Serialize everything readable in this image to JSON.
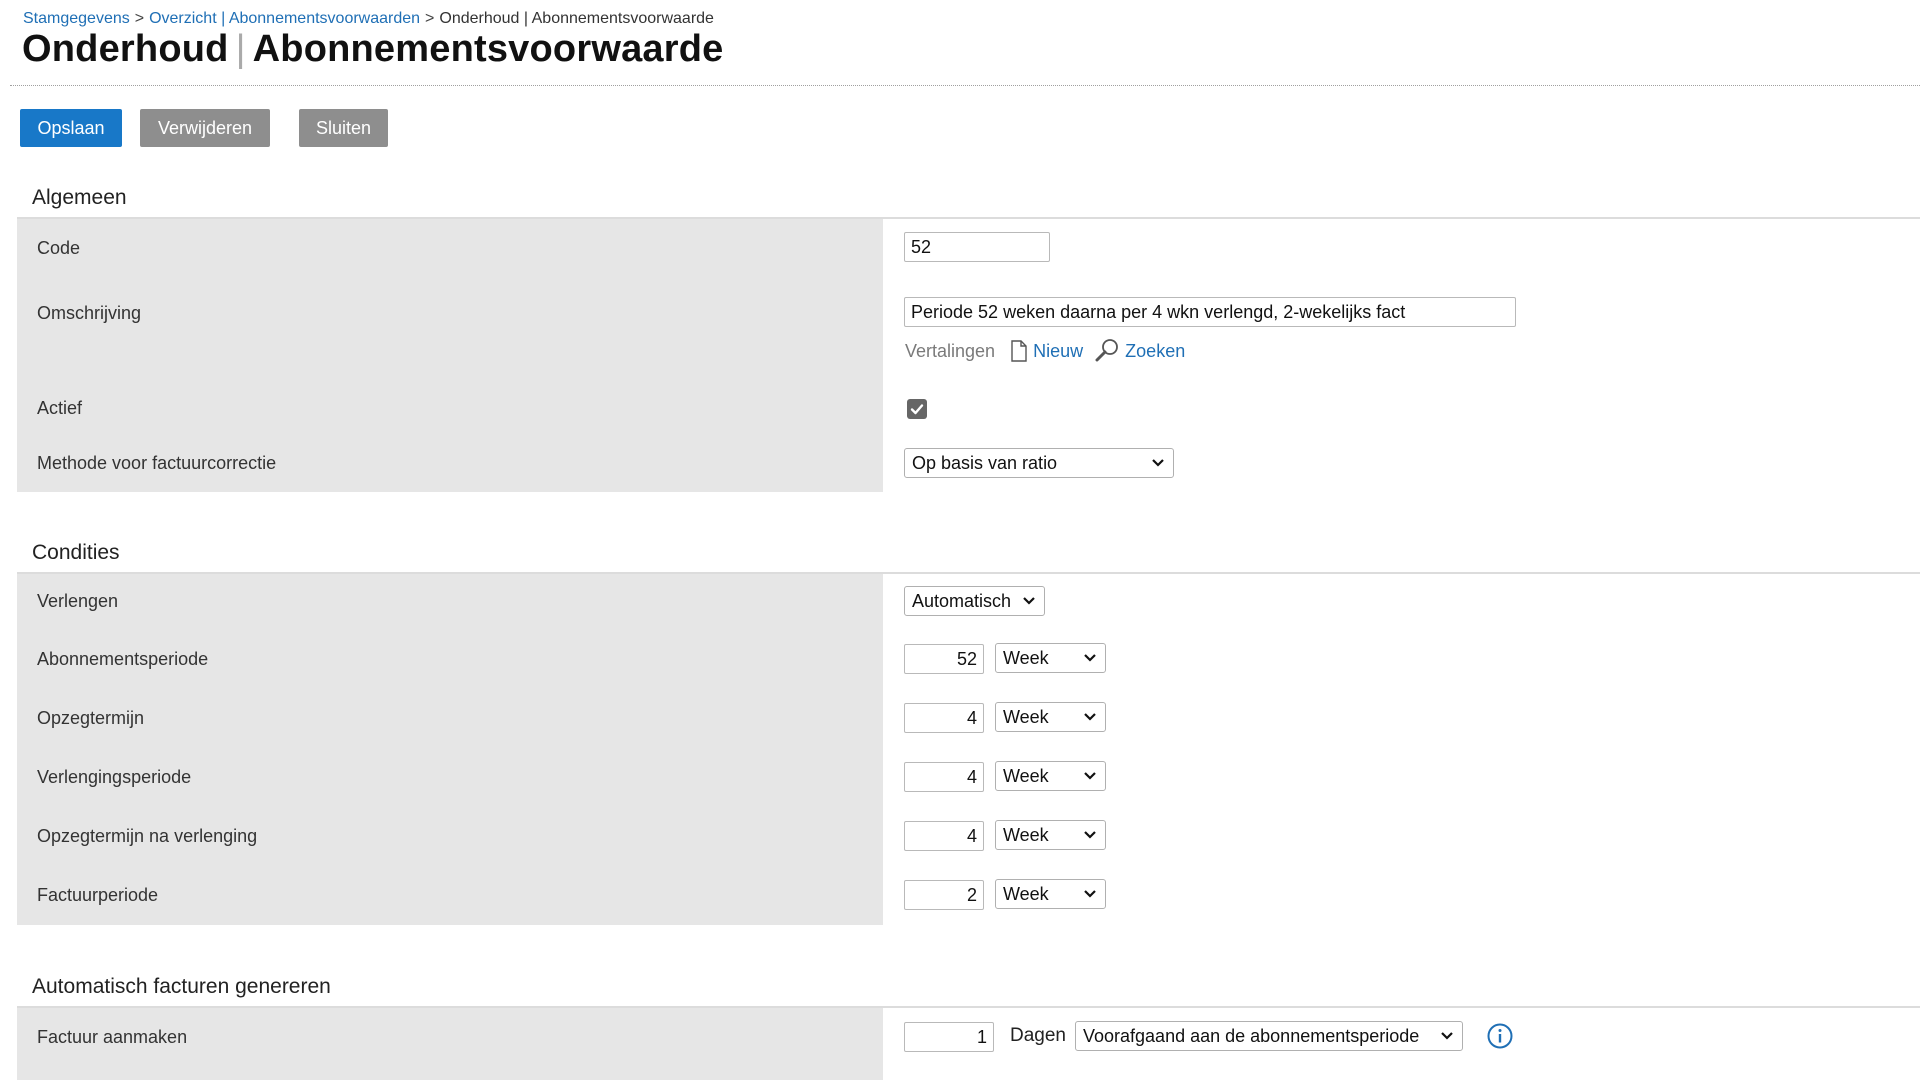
{
  "breadcrumb": {
    "items": [
      "Stamgegevens",
      "Overzicht | Abonnementsvoorwaarden",
      "Onderhoud | Abonnementsvoorwaarde"
    ],
    "separator": ">"
  },
  "page": {
    "title_part1": "Onderhoud",
    "title_separator": "|",
    "title_part2": "Abonnementsvoorwaarde"
  },
  "toolbar": {
    "save_label": "Opslaan",
    "delete_label": "Verwijderen",
    "close_label": "Sluiten"
  },
  "colors": {
    "primary_button": "#1878c8",
    "secondary_button": "#8e8e8e",
    "label_background": "#e6e6e6",
    "link": "#1f6fb5"
  },
  "general": {
    "title": "Algemeen",
    "code_label": "Code",
    "code_value": "52",
    "description_label": "Omschrijving",
    "description_value": "Periode 52 weken daarna per 4 wkn verlengd, 2-wekelijks fact",
    "translations_label": "Vertalingen",
    "new_label": "Nieuw",
    "search_label": "Zoeken",
    "active_label": "Actief",
    "active_checked": true,
    "correction_method_label": "Methode voor factuurcorrectie",
    "correction_method_value": "Op basis van ratio"
  },
  "conditions": {
    "title": "Condities",
    "extend_label": "Verlengen",
    "extend_value": "Automatisch",
    "rows": [
      {
        "label": "Abonnementsperiode",
        "value": "52",
        "unit": "Week"
      },
      {
        "label": "Opzegtermijn",
        "value": "4",
        "unit": "Week"
      },
      {
        "label": "Verlengingsperiode",
        "value": "4",
        "unit": "Week"
      },
      {
        "label": "Opzegtermijn na verlenging",
        "value": "4",
        "unit": "Week"
      },
      {
        "label": "Factuurperiode",
        "value": "2",
        "unit": "Week"
      }
    ]
  },
  "auto_invoice": {
    "title": "Automatisch facturen genereren",
    "create_label": "Factuur aanmaken",
    "create_value": "1",
    "days_label": "Dagen",
    "timing_value": "Voorafgaand aan de abonnementsperiode",
    "info_icon": "info-icon"
  }
}
